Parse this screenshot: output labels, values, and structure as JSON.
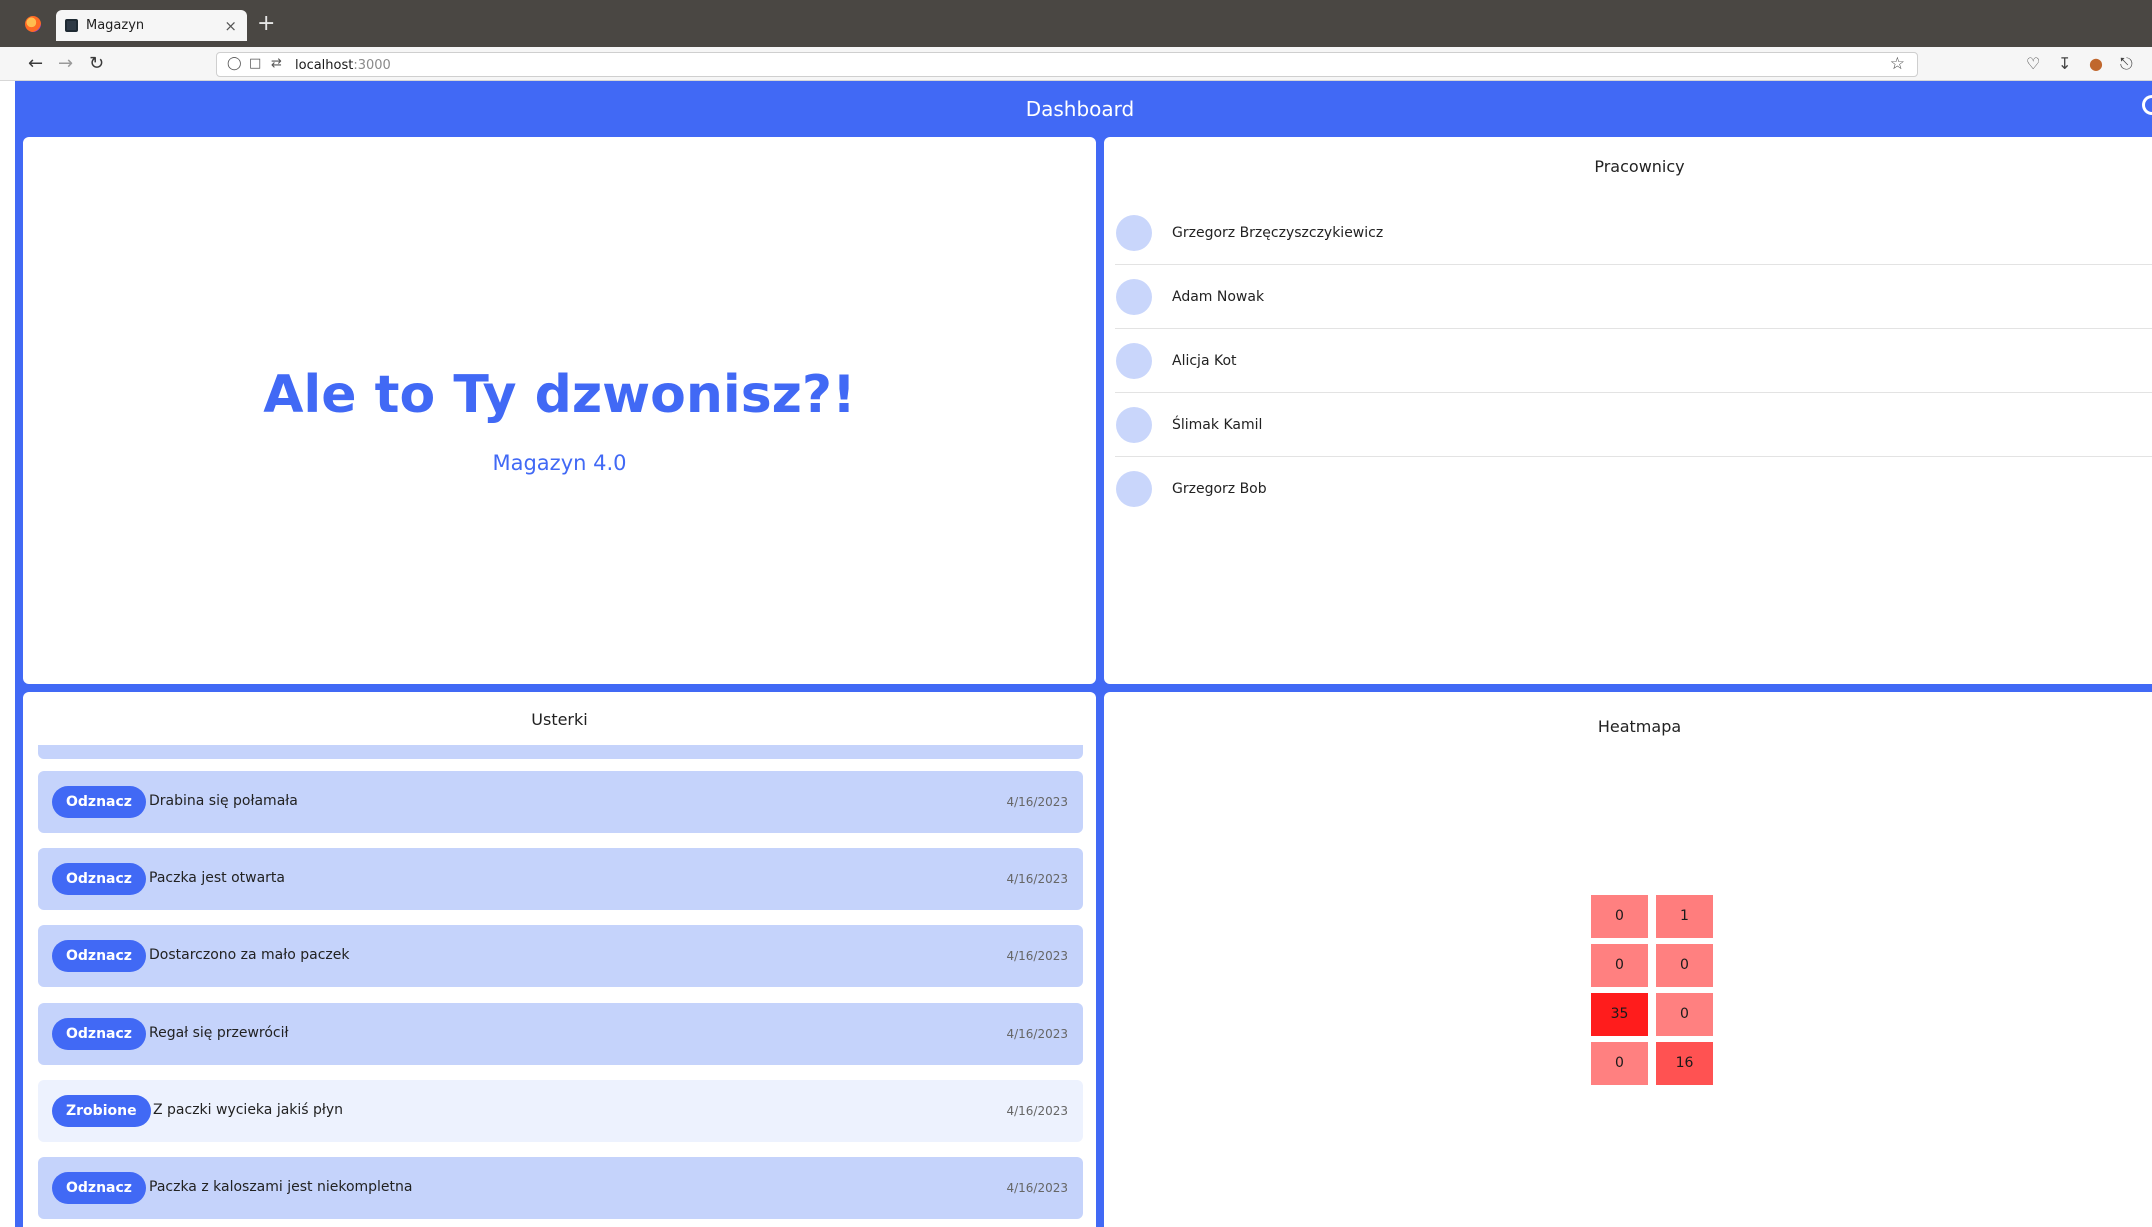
{
  "browser": {
    "tab_title": "Magazyn",
    "tab_close": "×",
    "new_tab": "+",
    "url_host": "localhost",
    "url_port": ":3000",
    "icons": [
      "back-icon",
      "forward-icon",
      "reload-icon",
      "shield-icon",
      "page-icon",
      "permissions-icon",
      "bookmark-star-icon",
      "pocket-icon",
      "download-icon",
      "account-icon",
      "extensions-icon"
    ]
  },
  "header": {
    "title": "Dashboard"
  },
  "hero": {
    "title": "Ale to Ty dzwonisz?!",
    "subtitle": "Magazyn 4.0"
  },
  "workers": {
    "title": "Pracownicy",
    "items": [
      {
        "name": "Grzegorz Brzęczyszczykiewicz"
      },
      {
        "name": "Adam Nowak"
      },
      {
        "name": "Alicja Kot"
      },
      {
        "name": "Ślimak Kamil"
      },
      {
        "name": "Grzegorz Bob"
      }
    ]
  },
  "issues": {
    "title": "Usterki",
    "items": [
      {
        "button": "Odznacz",
        "text": "Drabina się połamała",
        "date": "4/16/2023",
        "status": "open"
      },
      {
        "button": "Odznacz",
        "text": "Paczka jest otwarta",
        "date": "4/16/2023",
        "status": "open"
      },
      {
        "button": "Odznacz",
        "text": "Dostarczono za mało paczek",
        "date": "4/16/2023",
        "status": "open"
      },
      {
        "button": "Odznacz",
        "text": "Regał się przewrócił",
        "date": "4/16/2023",
        "status": "open"
      },
      {
        "button": "Zrobione",
        "text": "Z paczki wycieka jakiś płyn",
        "date": "4/16/2023",
        "status": "done"
      },
      {
        "button": "Odznacz",
        "text": "Paczka z kaloszami jest niekompletna",
        "date": "4/16/2023",
        "status": "open"
      }
    ]
  },
  "heatmap": {
    "title": "Heatmapa",
    "rows": [
      [
        0,
        1
      ],
      [
        0,
        0
      ],
      [
        35,
        0
      ],
      [
        0,
        16
      ]
    ],
    "max": 35
  },
  "colors": {
    "accent": "#4169f5",
    "issue_open": "#c5d3fb",
    "issue_done": "#edf2fe",
    "avatar": "#c9d6fb"
  }
}
